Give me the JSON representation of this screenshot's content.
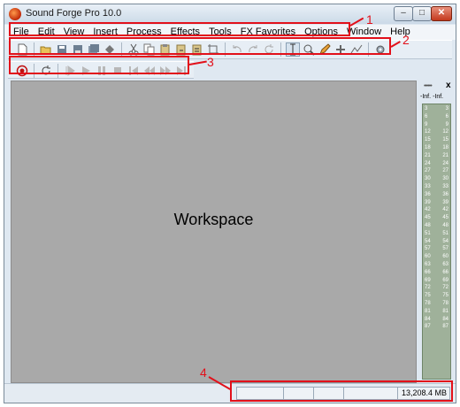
{
  "window": {
    "title": "Sound Forge Pro 10.0",
    "controls": {
      "minimize": "–",
      "maximize": "□",
      "close": "✕"
    }
  },
  "menubar": {
    "items": [
      "File",
      "Edit",
      "View",
      "Insert",
      "Process",
      "Effects",
      "Tools",
      "FX Favorites",
      "Options",
      "Window",
      "Help"
    ]
  },
  "toolbar_standard": {
    "icons": [
      "new-icon",
      "open-icon",
      "save-icon",
      "save-as-icon",
      "save-all-icon",
      "render-icon",
      "cut-icon",
      "copy-icon",
      "paste-icon",
      "paste-special-icon",
      "mix-icon",
      "crop-icon",
      "undo-icon",
      "redo-icon",
      "repeat-icon",
      "edit-tool-icon",
      "magnify-tool-icon",
      "pencil-tool-icon",
      "event-tool-icon",
      "envelope-tool-icon",
      "properties-icon"
    ]
  },
  "toolbar_transport": {
    "icons": [
      "record-icon",
      "loop-icon",
      "play-all-icon",
      "play-icon",
      "pause-icon",
      "stop-icon",
      "go-to-start-icon",
      "rewind-icon",
      "forward-icon",
      "go-to-end-icon"
    ]
  },
  "workspace": {
    "label": "Workspace"
  },
  "meters": {
    "grip": "••••••",
    "close": "x",
    "peak_left": "-Inf.",
    "peak_right": "-Inf.",
    "scale": [
      "3",
      "6",
      "9",
      "12",
      "15",
      "18",
      "21",
      "24",
      "27",
      "30",
      "33",
      "36",
      "39",
      "42",
      "45",
      "48",
      "51",
      "54",
      "57",
      "60",
      "63",
      "66",
      "69",
      "72",
      "75",
      "78",
      "81",
      "84",
      "87"
    ]
  },
  "statusbar": {
    "memory": "13,208.4 MB"
  },
  "callouts": [
    "1",
    "2",
    "3",
    "4"
  ],
  "colors": {
    "callout": "#e2101a",
    "workspace": "#a9a9a9",
    "meter": "#9fb19a"
  }
}
